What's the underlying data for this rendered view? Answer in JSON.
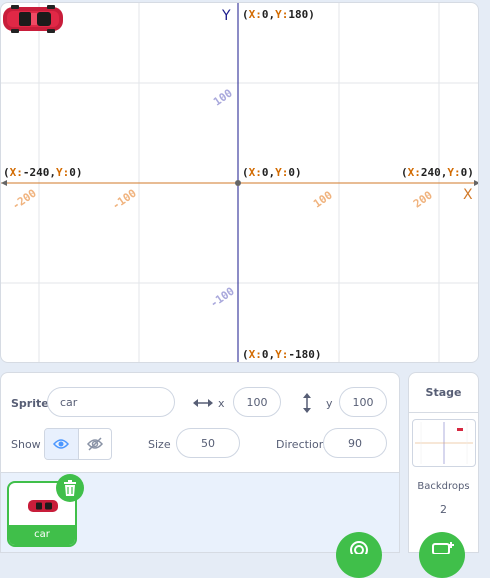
{
  "stage": {
    "axis_x_letter": "X",
    "axis_y_letter": "Y",
    "labels": {
      "top": {
        "k1": "X:",
        "v1": "0",
        "k2": "Y:",
        "v2": "180"
      },
      "bottom": {
        "k1": "X:",
        "v1": "0",
        "k2": "Y:",
        "v2": "-180"
      },
      "left": {
        "k1": "X:",
        "v1": "-240",
        "k2": "Y:",
        "v2": "0"
      },
      "right": {
        "k1": "X:",
        "v1": "240",
        "k2": "Y:",
        "v2": "0"
      },
      "center": {
        "k1": "X:",
        "v1": "0",
        "k2": "Y:",
        "v2": "0"
      }
    },
    "ticks": {
      "x_neg200": "-200",
      "x_neg100": "-100",
      "x_100": "100",
      "x_200": "200",
      "y_100": "100",
      "y_neg100": "-100"
    },
    "sprite_icon": "car-sprite",
    "colors": {
      "axis": "#1a1a8c",
      "x_axis": "#d27a2a",
      "grid": "#e3e6ea",
      "tick_y": "#a9a8dc",
      "tick_x": "#f0b37e"
    }
  },
  "sprite_info": {
    "sprite_label": "Sprite",
    "sprite_name": "car",
    "x_label": "x",
    "x_value": "100",
    "y_label": "y",
    "y_value": "100",
    "show_label": "Show",
    "size_label": "Size",
    "size_value": "50",
    "direction_label": "Direction",
    "direction_value": "90",
    "show_icons": [
      "eye-icon",
      "eye-slash-icon"
    ],
    "accent": "#4c97ff"
  },
  "sprite_list": {
    "tile_name": "car",
    "accent": "#40bf4a"
  },
  "stage_panel": {
    "title": "Stage",
    "backdrops_label": "Backdrops",
    "backdrops_count": "2"
  }
}
